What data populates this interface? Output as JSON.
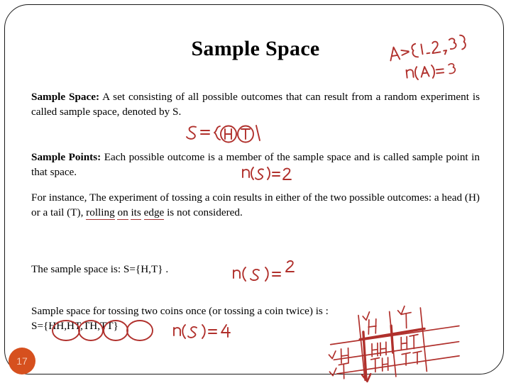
{
  "slide": {
    "title": "Sample Space",
    "number": "17",
    "accent_color": "#d6501e",
    "ink_color": "#b0302c",
    "text_color": "#000000"
  },
  "content": {
    "paragraph_1": {
      "lead": "Sample Space:",
      "text": " A set consisting of all possible outcomes that can result from a random experiment is called sample space, denoted by S."
    },
    "paragraph_2": {
      "lead": "Sample Points:",
      "text": " Each possible outcome is a member of the sample space and is called sample point in that space."
    },
    "paragraph_3": {
      "part_a": "For instance, The experiment of tossing a coin results in either of the two possible outcomes: a head (H) or a tail (T), ",
      "underlined_1": "rolling",
      "underlined_2": "on",
      "mid_1": " ",
      "underlined_3": "its",
      "underlined_4": "edge",
      "part_b": " is not considered."
    },
    "paragraph_4": {
      "text": "The sample space is: S={H,T} ."
    },
    "paragraph_5": {
      "line_1": "Sample space for tossing two coins once (or tossing a coin twice) is :",
      "line_2": "S={HH,HT,TH,TT}"
    }
  },
  "annotations": {
    "note_set_a": "A={1,2,3}",
    "note_n_a": "n(A)=3",
    "note_sample_space": "S={H,T}",
    "note_n_s_2a": "n(S)=2",
    "note_n_s_2b": "n(S)=2",
    "note_n_s_4": "n(S)=4",
    "grid": {
      "col_headers": [
        "H",
        "T"
      ],
      "row_headers": [
        "H",
        "T"
      ],
      "cells": [
        [
          "HH",
          "HT"
        ],
        [
          "TH",
          "TT"
        ]
      ]
    },
    "circled_terms": [
      "H",
      "T",
      "HH",
      "HT",
      "TH",
      "TT"
    ],
    "underlined_phrase": "rolling on its edge"
  }
}
